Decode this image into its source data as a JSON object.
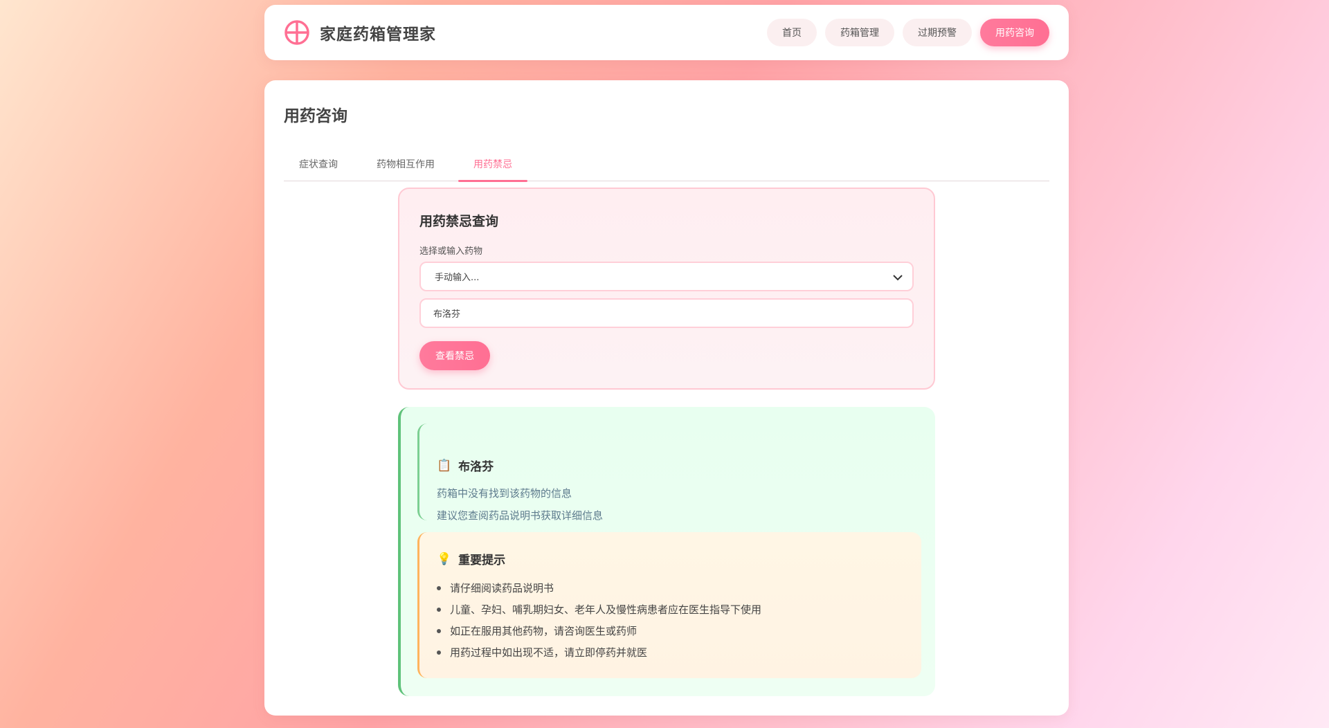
{
  "header": {
    "brand": "家庭药箱管理家",
    "nav": [
      "首页",
      "药箱管理",
      "过期预警",
      "用药咨询"
    ],
    "active_nav": "用药咨询"
  },
  "page": {
    "title": "用药咨询",
    "tabs": [
      "症状查询",
      "药物相互作用",
      "用药禁忌"
    ],
    "active_tab": "用药禁忌"
  },
  "query": {
    "title": "用药禁忌查询",
    "select_label": "选择或输入药物",
    "select_value": "手动输入...",
    "input_value": "布洛芬",
    "button_label": "查看禁忌"
  },
  "result": {
    "drug_icon": "📋",
    "drug_name": "布洛芬",
    "line1": "药箱中没有找到该药物的信息",
    "line2": "建议您查阅药品说明书获取详细信息"
  },
  "tips": {
    "icon": "💡",
    "title": "重要提示",
    "items": [
      "请仔细阅读药品说明书",
      "儿童、孕妇、哺乳期妇女、老年人及慢性病患者应在医生指导下使用",
      "如正在服用其他药物，请咨询医生或药师",
      "用药过程中如出现不适，请立即停药并就医"
    ]
  },
  "colors": {
    "accent": "#ff6f93",
    "success_border": "#5fc27a",
    "warning_border": "#ffb45e"
  }
}
